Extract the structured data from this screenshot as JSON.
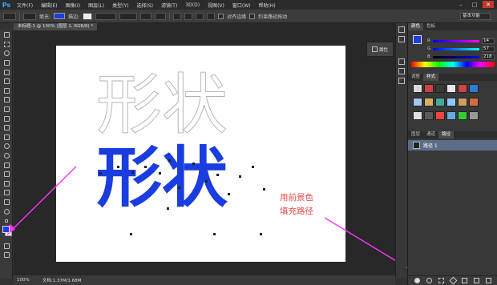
{
  "app": {
    "logo": "Ps"
  },
  "menubar": {
    "items": [
      "文件(F)",
      "编辑(E)",
      "图像(I)",
      "图层(L)",
      "类型(Y)",
      "选择(S)",
      "滤镜(T)",
      "3D(D)",
      "视图(V)",
      "窗口(W)",
      "帮助(H)"
    ],
    "controls": [
      "–",
      "□",
      "✕"
    ]
  },
  "options_bar": {
    "fill_label": "填充:",
    "stroke_label": "描边:",
    "align_edges_label": "对齐边缘",
    "constrain_label": "约束路径拖动",
    "workspace": "基本功能",
    "fill_color": "#1f3fd6"
  },
  "document": {
    "tab_title": "未标题-1 @ 100% (图层 1, RGB/8) *",
    "zoom": "100%",
    "doc_info": "文档:1.37M/1.68M"
  },
  "canvas_shapes": {
    "outline_text": "形状",
    "filled_text": "形状",
    "fill_color": "#1a3de0"
  },
  "annotation": {
    "line1": "用前景色",
    "line2": "填充路径",
    "color": "#ff33ff"
  },
  "mini_panel": {
    "history_label": "属性"
  },
  "color_panel": {
    "tabs": [
      "颜色",
      "色板"
    ],
    "channels": [
      {
        "label": "R",
        "value": "14"
      },
      {
        "label": "G",
        "value": "57"
      },
      {
        "label": "B",
        "value": "218"
      }
    ],
    "foreground": "#1e3ee8"
  },
  "adjust_panel": {
    "tabs": [
      "调整",
      "样式"
    ],
    "swatches": [
      "#d9d9d9",
      "#d04040",
      "#3a3a3a",
      "#e8e8e8",
      "#c44",
      "#2e7bd6",
      "#a0c8f0",
      "#d8b060",
      "#4a9",
      "#8cf",
      "#c8a060",
      "#d96b3a",
      "#e0e0e0",
      "#5a5a5a",
      "#e44",
      "#6ad",
      "#3c3",
      "#999"
    ]
  },
  "paths_panel": {
    "tabs": [
      "图层",
      "通道",
      "路径"
    ],
    "items": [
      {
        "label": "路径 1"
      }
    ]
  }
}
